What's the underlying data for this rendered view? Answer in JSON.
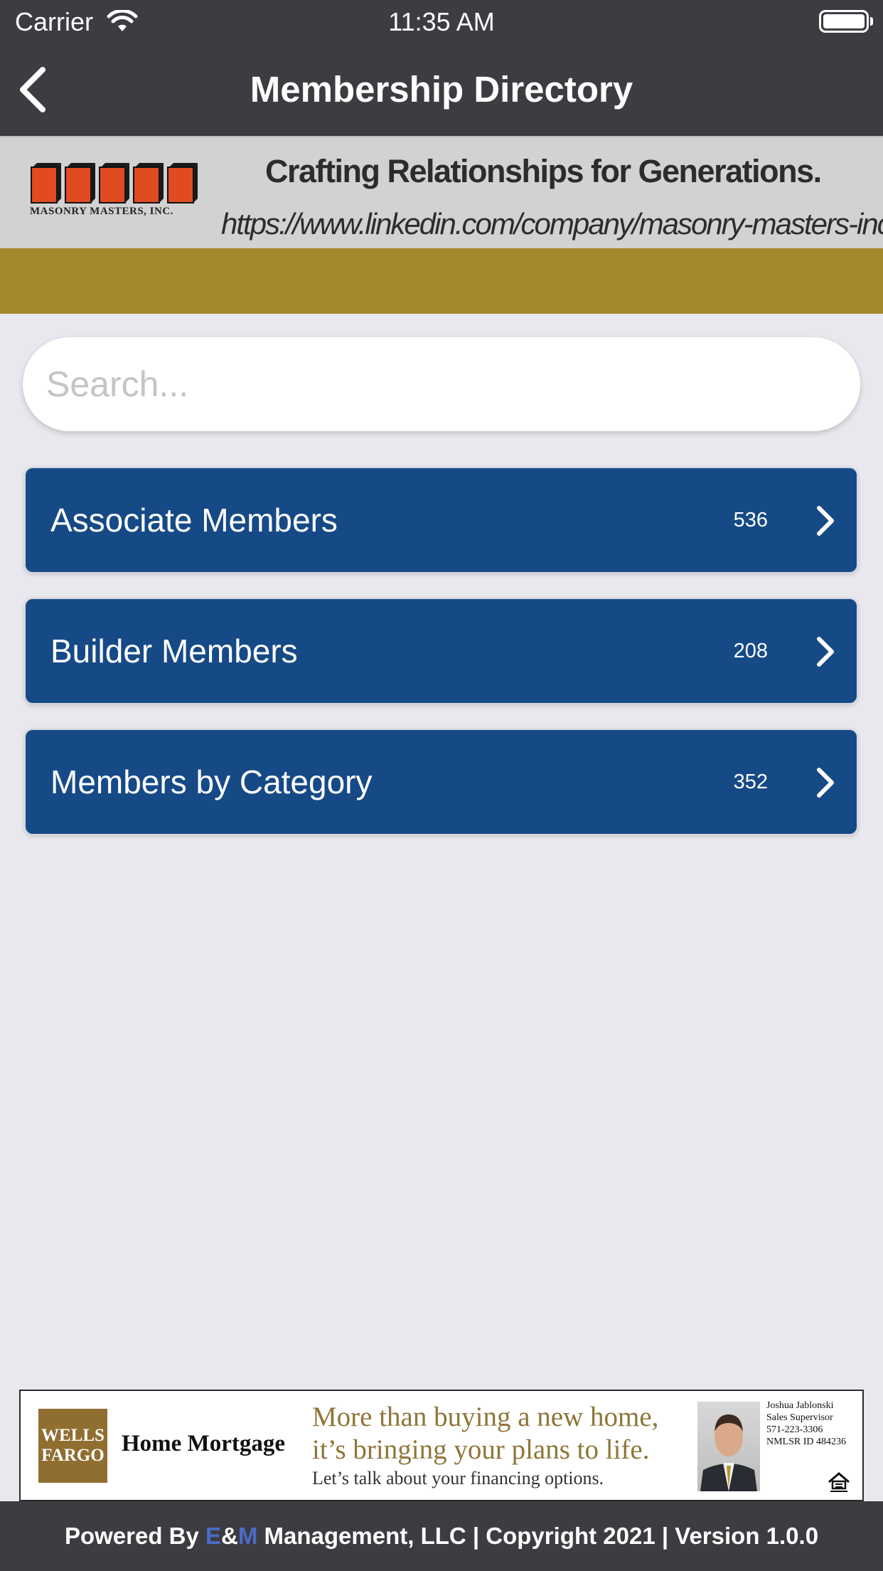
{
  "status_bar": {
    "carrier": "Carrier",
    "time": "11:35 AM"
  },
  "nav": {
    "title": "Membership Directory"
  },
  "banner_ad": {
    "logo_text": "MASONRY MASTERS, INC.",
    "tagline": "Crafting Relationships for Generations.",
    "url": "https://www.linkedin.com/company/masonry-masters-inc"
  },
  "search": {
    "placeholder": "Search..."
  },
  "rows": [
    {
      "label": "Associate Members",
      "count": "536"
    },
    {
      "label": "Builder Members",
      "count": "208"
    },
    {
      "label": "Members by Category",
      "count": "352"
    }
  ],
  "bottom_ad": {
    "logo_line1": "WELLS",
    "logo_line2": "FARGO",
    "product": "Home Mortgage",
    "headline_line1": "More than buying a new home,",
    "headline_line2": "it’s bringing your plans to life.",
    "subline": "Let’s talk about your financing options.",
    "contact_name": "Joshua Jablonski",
    "contact_title": "Sales Supervisor",
    "contact_phone": "571-223-3306",
    "contact_nmls": "NMLSR ID 484236"
  },
  "footer": {
    "prefix": "Powered By ",
    "e": "E",
    "amp": "&",
    "m": "M",
    "suffix": " Management, LLC | Copyright 2021 | Version 1.0.0"
  },
  "colors": {
    "nav_background": "#3d3c41",
    "gold_bar": "#a5872e",
    "row_background": "#164a86",
    "page_background": "#e9e8ee",
    "footer_accent": "#4d6cc9"
  }
}
